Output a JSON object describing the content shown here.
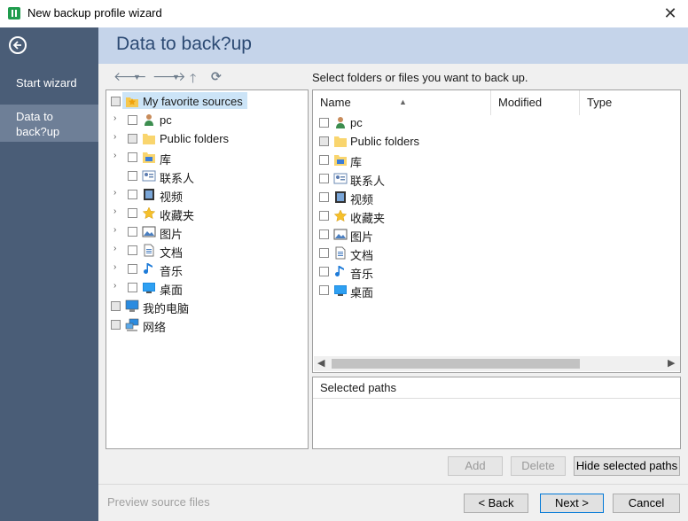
{
  "window": {
    "title": "New backup profile wizard"
  },
  "sidebar": {
    "items": [
      {
        "label": "Start wizard"
      },
      {
        "label": "Data to back?up"
      }
    ]
  },
  "header": {
    "title": "Data to back?up"
  },
  "instruction": "Select folders or files you want to back up.",
  "tree": {
    "items": [
      {
        "label": "My favorite sources",
        "icon": "star-folder-icon"
      },
      {
        "label": "pc",
        "icon": "user-icon"
      },
      {
        "label": "Public folders",
        "icon": "folder-icon"
      },
      {
        "label": "库",
        "icon": "library-icon"
      },
      {
        "label": "联系人",
        "icon": "contacts-icon"
      },
      {
        "label": "视频",
        "icon": "video-icon"
      },
      {
        "label": "收藏夹",
        "icon": "star-icon"
      },
      {
        "label": "图片",
        "icon": "picture-icon"
      },
      {
        "label": "文档",
        "icon": "document-icon"
      },
      {
        "label": "音乐",
        "icon": "music-icon"
      },
      {
        "label": "桌面",
        "icon": "desktop-icon"
      },
      {
        "label": "我的电脑",
        "icon": "computer-icon"
      },
      {
        "label": "网络",
        "icon": "network-icon"
      }
    ]
  },
  "list": {
    "columns": [
      "Name",
      "Modified",
      "Type"
    ],
    "rows": [
      {
        "label": "pc"
      },
      {
        "label": "Public folders"
      },
      {
        "label": "库"
      },
      {
        "label": "联系人"
      },
      {
        "label": "视频"
      },
      {
        "label": "收藏夹"
      },
      {
        "label": "图片"
      },
      {
        "label": "文档"
      },
      {
        "label": "音乐"
      },
      {
        "label": "桌面"
      }
    ]
  },
  "selected_paths": {
    "header": "Selected paths"
  },
  "buttons": {
    "add": "Add",
    "delete": "Delete",
    "hide_selected": "Hide selected paths",
    "back": "< Back",
    "next": "Next >",
    "cancel": "Cancel"
  },
  "footer": {
    "preview": "Preview source files"
  },
  "colors": {
    "sidebar": "#4a5d77",
    "header": "#c5d4ea",
    "header_text": "#2c4a73",
    "accent": "#0078d7"
  }
}
